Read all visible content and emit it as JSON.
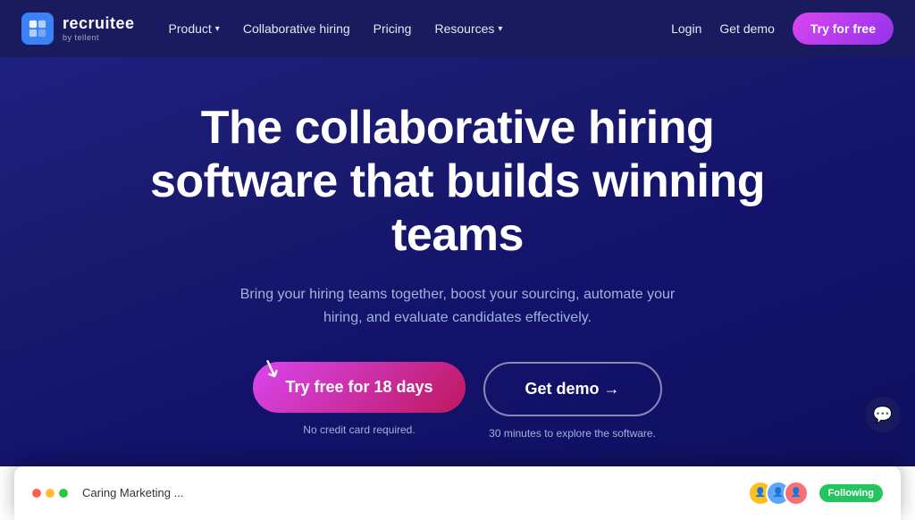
{
  "navbar": {
    "logo_name": "recruitee",
    "logo_sub": "by tellent",
    "nav_items": [
      {
        "label": "Product",
        "has_dropdown": true
      },
      {
        "label": "Collaborative hiring",
        "has_dropdown": false
      },
      {
        "label": "Pricing",
        "has_dropdown": false
      },
      {
        "label": "Resources",
        "has_dropdown": true
      }
    ],
    "login_label": "Login",
    "demo_label": "Get demo",
    "try_label": "Try for free"
  },
  "hero": {
    "title": "The collaborative hiring software that builds winning teams",
    "subtitle": "Bring your hiring teams together, boost your sourcing, automate your hiring, and evaluate candidates effectively.",
    "try_btn_label": "Try free for 18 days",
    "demo_btn_label": "Get demo →",
    "try_note": "No credit card required.",
    "demo_note": "30 minutes to explore the software."
  },
  "preview": {
    "dots": [
      "red",
      "yellow",
      "green"
    ],
    "content_text": "Caring Marketing ...",
    "following_label": "Following"
  },
  "chat": {
    "icon": "💬"
  }
}
